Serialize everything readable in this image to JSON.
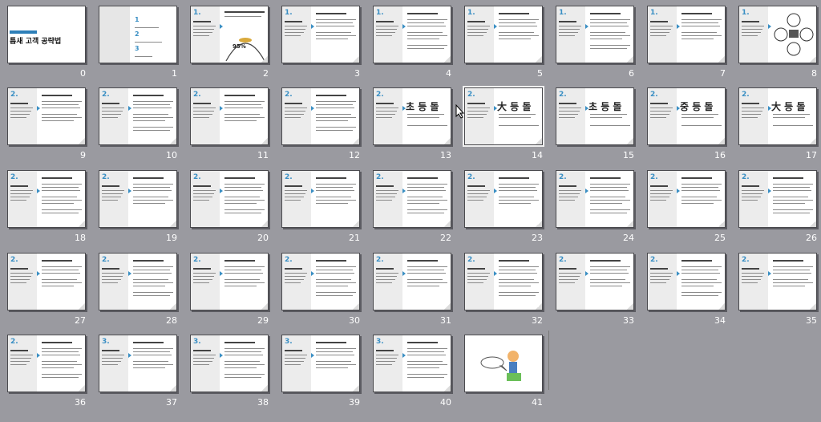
{
  "sorter": {
    "slide_numbers": [
      "0",
      "1",
      "2",
      "3",
      "4",
      "5",
      "6",
      "7",
      "8",
      "9",
      "10",
      "11",
      "12",
      "13",
      "14",
      "15",
      "16",
      "17",
      "18",
      "19",
      "20",
      "21",
      "22",
      "23",
      "24",
      "25",
      "26",
      "27",
      "28",
      "29",
      "30",
      "31",
      "32",
      "33",
      "34",
      "35",
      "36",
      "37",
      "38",
      "39",
      "40",
      "41"
    ],
    "cursor_icon": "mouse-pointer-icon"
  },
  "slide_texts": {
    "title_slide": "틈새 고객 공략법",
    "section_1": "1.",
    "section_2": "2.",
    "section_3": "3.",
    "toc_1": "1",
    "toc_2": "2",
    "toc_3": "3",
    "percent": "95%",
    "heading_13": "초 등 돌",
    "heading_14": "大 등 돌",
    "heading_15": "초 등 돌",
    "heading_16": "중 등 돌",
    "heading_17": "大 등 돌"
  }
}
